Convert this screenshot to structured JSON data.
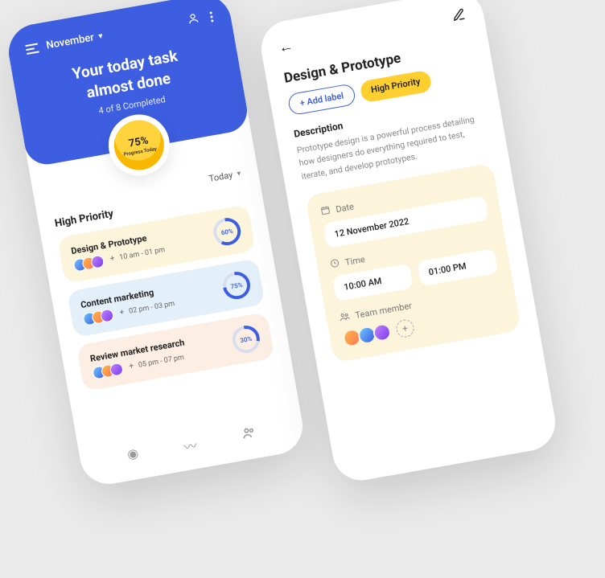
{
  "left": {
    "month": "November",
    "hero_line1": "Your today task",
    "hero_line2": "almost done",
    "hero_sub": "4 of 8 Completed",
    "progress_pct": "75%",
    "progress_label": "Progress Today",
    "today_label": "Today",
    "section_title": "High Priority",
    "cards": [
      {
        "title": "Design & Prototype",
        "time": "10 am - 01 pm",
        "pct": "60%"
      },
      {
        "title": "Content marketing",
        "time": "02 pm - 03 pm",
        "pct": "75%"
      },
      {
        "title": "Review market research",
        "time": "05 pm - 07 pm",
        "pct": "30%"
      }
    ]
  },
  "right": {
    "title": "Design & Prototype",
    "add_label": "+ Add label",
    "priority_chip": "High Priority",
    "desc_title": "Description",
    "desc_text": "Prototype design is a powerful process detailing how designers do everything required to test, iterate, and develop prototypes.",
    "date_label": "Date",
    "date_value": "12 November 2022",
    "time_label": "Time",
    "time_start": "10:00 AM",
    "time_end": "01:00 PM",
    "member_label": "Team member"
  }
}
